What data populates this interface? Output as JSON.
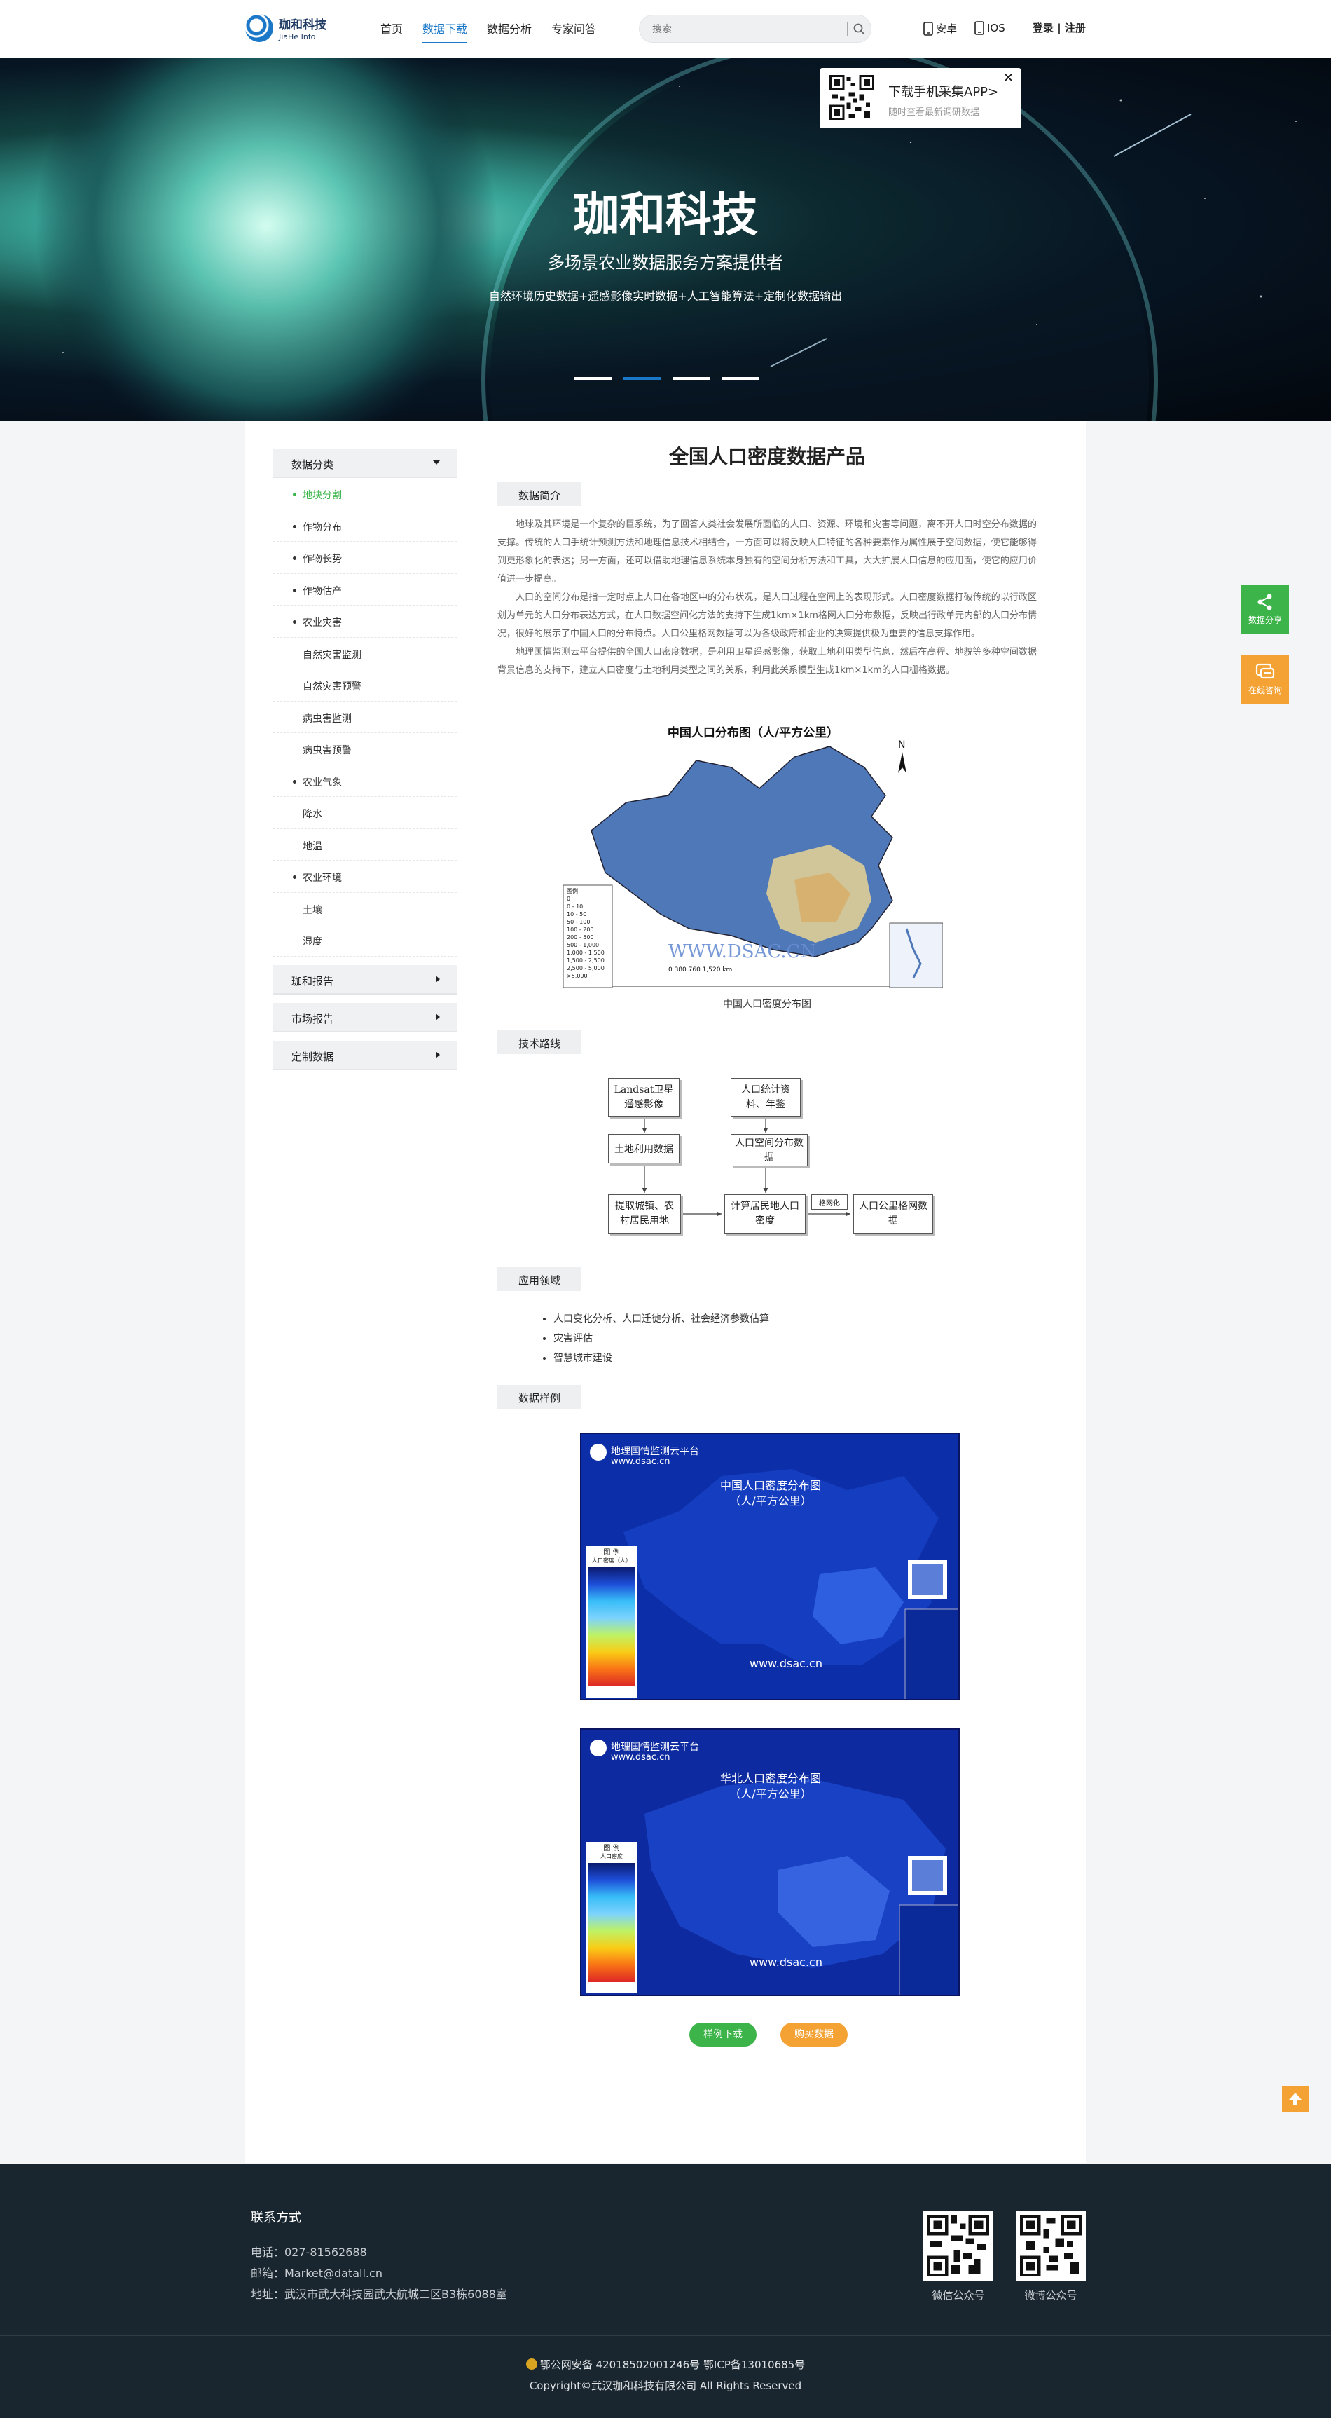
{
  "header": {
    "logo_cn": "珈和科技",
    "logo_en": "JiaHe Info",
    "nav": [
      "首页",
      "数据下载",
      "数据分析",
      "专家问答"
    ],
    "search_placeholder": "搜索",
    "android": "安卓",
    "ios": "IOS",
    "login": "登录 | 注册"
  },
  "banner": {
    "title": "珈和科技",
    "subtitle": "多场景农业数据服务方案提供者",
    "desc": "自然环境历史数据+遥感影像实时数据+人工智能算法+定制化数据输出",
    "slides": 4,
    "active_slide": 2,
    "app_popup_title": "下载手机采集APP>",
    "app_popup_sub": "随时查看最新调研数据"
  },
  "sidebar": {
    "category_title": "数据分类",
    "items": [
      {
        "label": "地块分割",
        "level": 1,
        "active": true
      },
      {
        "label": "作物分布",
        "level": 1
      },
      {
        "label": "作物长势",
        "level": 1
      },
      {
        "label": "作物估产",
        "level": 1
      },
      {
        "label": "农业灾害",
        "level": 1
      },
      {
        "label": "自然灾害监测",
        "level": 2
      },
      {
        "label": "自然灾害预警",
        "level": 2
      },
      {
        "label": "病虫害监测",
        "level": 2
      },
      {
        "label": "病虫害预警",
        "level": 2
      },
      {
        "label": "农业气象",
        "level": 1
      },
      {
        "label": "降水",
        "level": 2
      },
      {
        "label": "地温",
        "level": 2
      },
      {
        "label": "农业环境",
        "level": 1
      },
      {
        "label": "土壤",
        "level": 2
      },
      {
        "label": "湿度",
        "level": 2
      }
    ],
    "sections": [
      "珈和报告",
      "市场报告",
      "定制数据"
    ]
  },
  "content": {
    "title": "全国人口密度数据产品",
    "intro_tag": "数据简介",
    "para1": "地球及其环境是一个复杂的巨系统，为了回答人类社会发展所面临的人口、资源、环境和灾害等问题，离不开人口时空分布数据的支撑。传统的人口手统计预测方法和地理信息技术相结合，一方面可以将反映人口特征的各种要素作为属性展于空间数据，使它能够得到更形象化的表达；另一方面，还可以借助地理信息系统本身独有的空间分析方法和工具，大大扩展人口信息的应用面，使它的应用价值进一步提高。",
    "para2": "人口的空间分布是指一定时点上人口在各地区中的分布状况，是人口过程在空间上的表现形式。人口密度数据打破传统的以行政区划为单元的人口分布表达方式，在人口数据空间化方法的支持下生成1km×1km格网人口分布数据，反映出行政单元内部的人口分布情况，很好的展示了中国人口的分布特点。人口公里格网数据可以为各级政府和企业的决策提供极为重要的信息支撑作用。",
    "para3": "地理国情监测云平台提供的全国人口密度数据，是利用卫星遥感影像，获取土地利用类型信息，然后在高程、地貌等多种空间数据背景信息的支持下，建立人口密度与土地利用类型之间的关系，利用此关系模型生成1km×1km的人口栅格数据。",
    "map1_title": "中国人口分布图（人/平方公里）",
    "map1_watermark": "WWW.DSAC.CN",
    "map1_legend_title": "图例",
    "map1_legend": [
      "0",
      "0 - 10",
      "10 - 50",
      "50 - 100",
      "100 - 200",
      "200 - 500",
      "500 - 1,000",
      "1,000 - 1,500",
      "1,500 - 2,500",
      "2,500 - 5,000",
      ">5,000"
    ],
    "map1_scale": "0    380    760        1,520 km",
    "map1_caption": "中国人口密度分布图",
    "tech_tag": "技术路线",
    "flow": {
      "landsat": "Landsat卫星遥感影像",
      "landuse": "土地利用数据",
      "extract": "提取城镇、农村居民用地",
      "stats": "人口统计资料、年鉴",
      "spatial": "人口空间分布数据",
      "calc": "计算居民地人口密度",
      "grid_label": "格网化",
      "result": "人口公里格网数据"
    },
    "app_tag": "应用领域",
    "apps": [
      "人口变化分析、人口迁徙分析、社会经济参数估算",
      "灾害评估",
      "智慧城市建设"
    ],
    "sample_tag": "数据样例",
    "sample1": {
      "platform": "地理国情监测云平台",
      "url": "www.dsac.cn",
      "title1": "中国人口密度分布图",
      "title2": "（人/平方公里）",
      "legend_title": "图  例",
      "legend_sub": "人口密度（人）",
      "watermark": "www.dsac.cn"
    },
    "sample2": {
      "platform": "地理国情监测云平台",
      "url": "www.dsac.cn",
      "title1": "华北人口密度分布图",
      "title2": "（人/平方公里）",
      "legend_title": "图  例",
      "legend_sub": "人口密度",
      "watermark": "www.dsac.cn"
    },
    "btn_sample": "样例下载",
    "btn_buy": "购买数据"
  },
  "float": {
    "share": "数据分享",
    "consult": "在线咨询"
  },
  "footer": {
    "title": "联系方式",
    "phone": "电话：027-81562688",
    "email": "邮箱：Market@datall.cn",
    "address": "地址：武汉市武大科技园武大航城二区B3栋6088室",
    "qr1": "微信公众号",
    "qr2": "微博公众号",
    "beian": "鄂公网安备 42018502001246号    鄂ICP备13010685号",
    "copyright": "Copyright©武汉珈和科技有限公司 All Rights Reserved"
  },
  "colors": {
    "brand_blue": "#1b78c8",
    "green": "#3cb44a",
    "orange": "#f4a233",
    "footer_bg": "#1a262f"
  }
}
